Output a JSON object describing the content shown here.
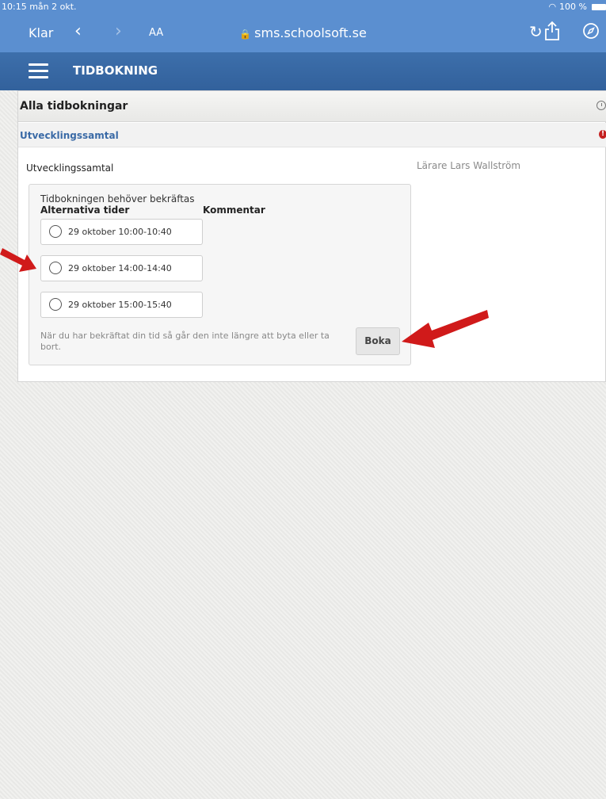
{
  "status_bar": {
    "time": "10:15",
    "date": "mån 2 okt.",
    "battery": "100 %"
  },
  "browser": {
    "done_label": "Klar",
    "text_size_label": "AA",
    "url": "sms.schoolsoft.se"
  },
  "app": {
    "title": "TIDBOKNING"
  },
  "panel": {
    "title": "Alla tidbokningar",
    "section": "Utvecklingssamtal",
    "meeting_name": "Utvecklingssamtal",
    "teacher": "Lärare Lars Wallström"
  },
  "booking": {
    "needs_confirmation": "Tidbokningen behöver bekräftas",
    "col_alternatives": "Alternativa tider",
    "col_comment": "Kommentar",
    "slots": [
      {
        "label": "29 oktober 10:00-10:40"
      },
      {
        "label": "29 oktober 14:00-14:40"
      },
      {
        "label": "29 oktober 15:00-15:40"
      }
    ],
    "note": "När du har bekräftat din tid så går den inte längre att byta eller ta bort.",
    "book_button": "Boka"
  },
  "colors": {
    "browser_bar": "#5b8fd0",
    "app_bar": "#3a69a5",
    "annotation_arrow": "#d01a1a",
    "section_title": "#3a6aa6"
  }
}
